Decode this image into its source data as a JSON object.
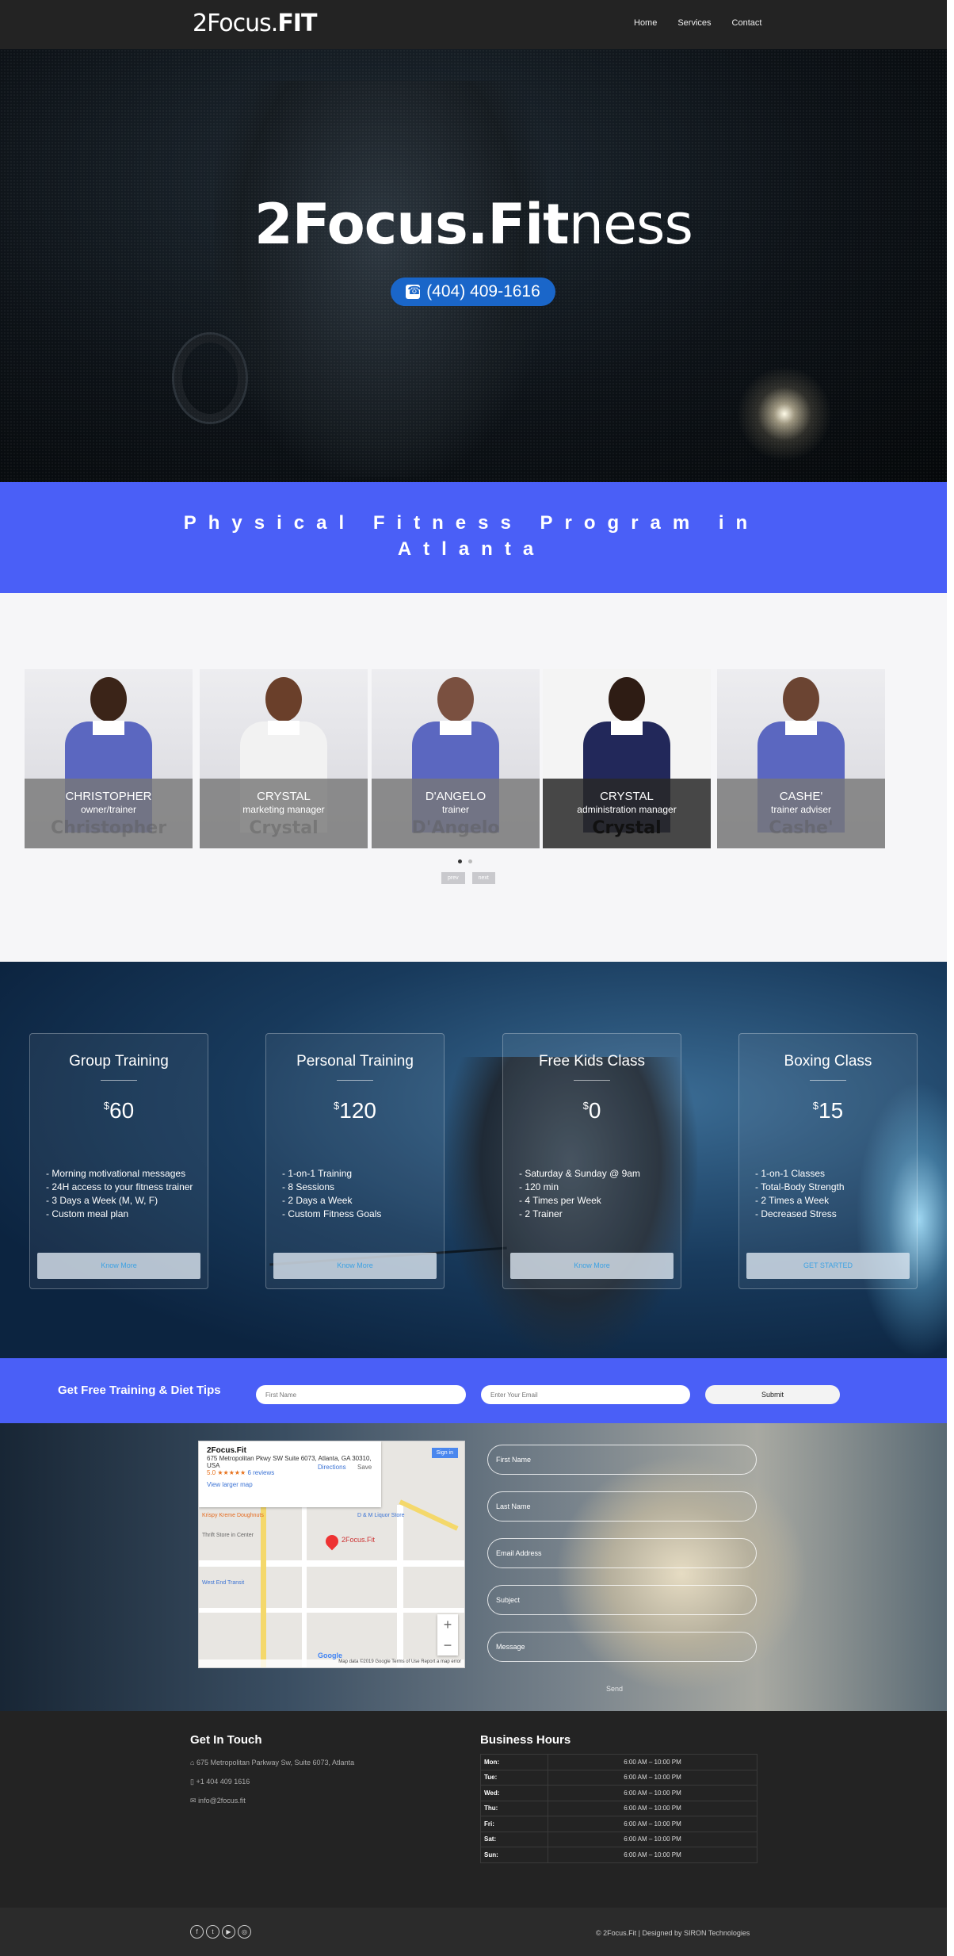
{
  "nav": {
    "logo_main": "2Focus.",
    "logo_fit": "FIT",
    "links": [
      "Home",
      "Services",
      "Contact"
    ]
  },
  "hero": {
    "title_bold": "2Focus.Fit",
    "title_rest": "ness",
    "phone": "(404) 409-1616"
  },
  "banner": {
    "text": "Physical Fitness Program in Atlanta"
  },
  "team": {
    "members": [
      {
        "name": "CHRISTOPHER",
        "role": "owner/trainer",
        "ghost": "Christopher"
      },
      {
        "name": "CRYSTAL",
        "role": "marketing manager",
        "ghost": "Crystal"
      },
      {
        "name": "D'ANGELO",
        "role": "trainer",
        "ghost": "D'Angelo"
      },
      {
        "name": "CRYSTAL",
        "role": "administration manager",
        "ghost": "Crystal"
      },
      {
        "name": "CASHE'",
        "role": "trainer adviser",
        "ghost": "Cashe'"
      }
    ],
    "prev": "prev",
    "next": "next"
  },
  "plans": [
    {
      "title": "Group Training",
      "currency": "$",
      "price": "60",
      "features": [
        "- Morning motivational messages",
        "- 24H access to your fitness trainer",
        "- 3 Days a Week (M, W, F)",
        "- Custom meal plan"
      ],
      "button": "Know More"
    },
    {
      "title": "Personal Training",
      "currency": "$",
      "price": "120",
      "features": [
        "- 1-on-1 Training",
        "- 8 Sessions",
        "- 2 Days a Week",
        "- Custom Fitness Goals"
      ],
      "button": "Know More"
    },
    {
      "title": "Free Kids Class",
      "currency": "$",
      "price": "0",
      "features": [
        "- Saturday & Sunday @ 9am",
        "- 120 min",
        "- 4 Times per Week",
        "- 2 Trainer"
      ],
      "button": "Know More"
    },
    {
      "title": "Boxing Class",
      "currency": "$",
      "price": "15",
      "features": [
        "- 1-on-1 Classes",
        "- Total-Body Strength",
        "- 2 Times a Week",
        "- Decreased Stress"
      ],
      "button": "GET STARTED"
    }
  ],
  "newsletter": {
    "label": "Get Free Training & Diet Tips",
    "first_name_placeholder": "First Name",
    "email_placeholder": "Enter Your Email",
    "submit": "Submit"
  },
  "map": {
    "place": "2Focus.Fit",
    "address": "675 Metropolitan Pkwy SW Suite 6073, Atlanta, GA 30310, USA",
    "rating": "5.0 ★★★★★",
    "reviews": "6 reviews",
    "larger": "View larger map",
    "directions": "Directions",
    "save": "Save",
    "signin": "Sign in",
    "pin": "2Focus.Fit",
    "store": "D & M Liquor Store",
    "krispy": "Krispy Kreme Doughnuts",
    "thrift": "Thrift Store in Center",
    "transit": "West End Transit",
    "attribution": "Map data ©2019 Google  Terms of Use  Report a map error",
    "google": "Google"
  },
  "form": {
    "first": "First Name",
    "last": "Last Name",
    "email": "Email Address",
    "subject": "Subject",
    "message": "Message",
    "send": "Send"
  },
  "footer": {
    "touch_title": "Get In Touch",
    "address": "675 Metropolitan Parkway Sw, Suite 6073, Atlanta",
    "phone": "+1 404 409 1616",
    "email": "info@2focus.fit",
    "hours_title": "Business Hours",
    "hours": [
      {
        "day": "Mon:",
        "time": "6:00 AM – 10:00 PM"
      },
      {
        "day": "Tue:",
        "time": "6:00 AM – 10:00 PM"
      },
      {
        "day": "Wed:",
        "time": "6:00 AM – 10:00 PM"
      },
      {
        "day": "Thu:",
        "time": "6:00 AM – 10:00 PM"
      },
      {
        "day": "Fri:",
        "time": "6:00 AM – 10:00 PM"
      },
      {
        "day": "Sat:",
        "time": "6:00 AM – 10:00 PM"
      },
      {
        "day": "Sun:",
        "time": "6:00 AM – 10:00 PM"
      }
    ],
    "copyright": "© 2Focus.Fit | Designed by SIRON Technologies"
  }
}
